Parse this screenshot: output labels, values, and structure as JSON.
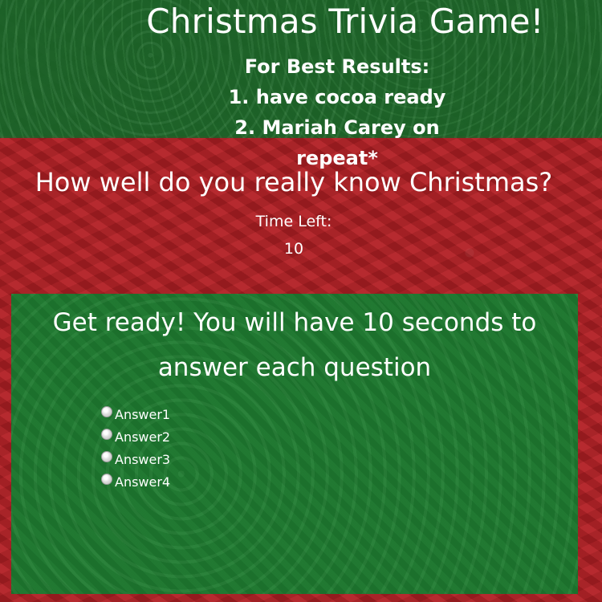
{
  "header": {
    "title": "Christmas Trivia Game!",
    "best_results_heading": "For Best Results:",
    "tips": [
      "1. have cocoa ready",
      "2. Mariah Carey on repeat*"
    ]
  },
  "game": {
    "subtitle": "How well do you really know Christmas?",
    "time_label": "Time Left:",
    "time_left": "10"
  },
  "quiz": {
    "question": "Get ready! You will have 10 seconds to answer each question",
    "answers": [
      "Answer1",
      "Answer2",
      "Answer3",
      "Answer4"
    ]
  },
  "colors": {
    "header_green": "#206b2b",
    "background_red": "#b31f24",
    "panel_green": "#1e7a2f",
    "text": "#ffffff"
  }
}
